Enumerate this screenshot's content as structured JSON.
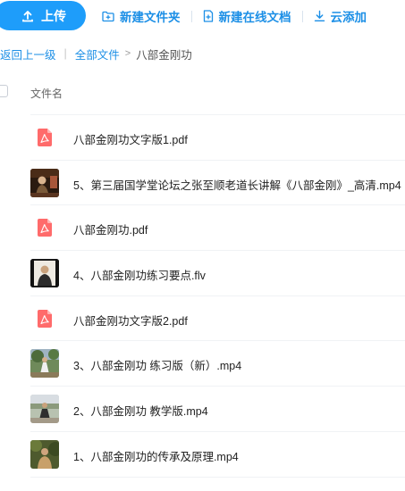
{
  "toolbar": {
    "upload_label": "上传",
    "new_folder_label": "新建文件夹",
    "new_online_doc_label": "新建在线文档",
    "cloud_add_label": "云添加"
  },
  "breadcrumb": {
    "back_label": "返回上一级",
    "separator": "|",
    "all_files_label": "全部文件",
    "chevron": ">",
    "current_folder": "八部金刚功"
  },
  "list": {
    "name_header": "文件名",
    "files": [
      {
        "name": "八部金刚功文字版1.pdf",
        "type": "pdf"
      },
      {
        "name": "5、第三届国学堂论坛之张至顺老道长讲解《八部金刚》_高清.mp4",
        "type": "video"
      },
      {
        "name": "八部金刚功.pdf",
        "type": "pdf"
      },
      {
        "name": "4、八部金刚功练习要点.flv",
        "type": "video"
      },
      {
        "name": "八部金刚功文字版2.pdf",
        "type": "pdf"
      },
      {
        "name": "3、八部金刚功 练习版（新）.mp4",
        "type": "video"
      },
      {
        "name": "2、八部金刚功 教学版.mp4",
        "type": "video"
      },
      {
        "name": "1、八部金刚功的传承及原理.mp4",
        "type": "video"
      }
    ]
  },
  "colors": {
    "accent": "#1e9dfa",
    "link": "#1c8fe6",
    "pdf": "#ff6b6b"
  }
}
